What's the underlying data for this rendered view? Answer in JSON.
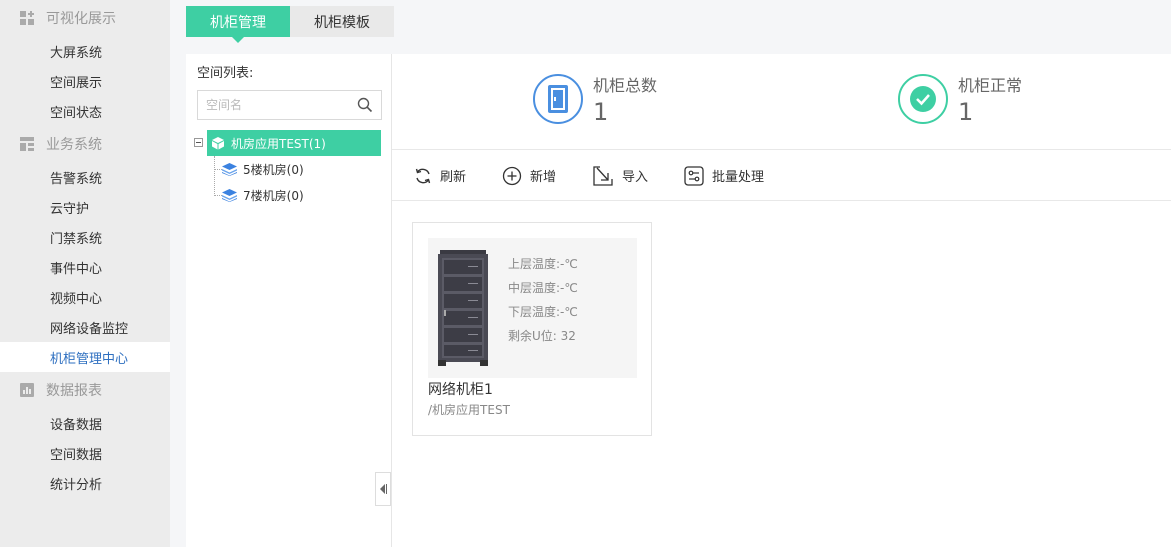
{
  "sidebar": {
    "groups": [
      {
        "title": "可视化展示",
        "icon": "grid-plus-icon",
        "items": [
          "大屏系统",
          "空间展示",
          "空间状态"
        ]
      },
      {
        "title": "业务系统",
        "icon": "layout-icon",
        "items": [
          "告警系统",
          "云守护",
          "门禁系统",
          "事件中心",
          "视频中心",
          "网络设备监控",
          "机柜管理中心"
        ]
      },
      {
        "title": "数据报表",
        "icon": "bar-chart-icon",
        "items": [
          "设备数据",
          "空间数据",
          "统计分析"
        ]
      }
    ],
    "active_item": "机柜管理中心"
  },
  "tabs": [
    {
      "label": "机柜管理",
      "active": true
    },
    {
      "label": "机柜模板",
      "active": false
    }
  ],
  "space_list": {
    "title": "空间列表:",
    "search_placeholder": "空间名",
    "root": "机房应用TEST(1)",
    "children": [
      "5楼机房(0)",
      "7楼机房(0)"
    ]
  },
  "stats": {
    "total_label": "机柜总数",
    "total_value": "1",
    "normal_label": "机柜正常",
    "normal_value": "1"
  },
  "toolbar": {
    "refresh": "刷新",
    "add": "新增",
    "import": "导入",
    "batch": "批量处理"
  },
  "cabinet": {
    "upper_temp": "上层温度:-℃",
    "middle_temp": "中层温度:-℃",
    "lower_temp": "下层温度:-℃",
    "remaining_u": "剩余U位:  32",
    "name": "网络机柜1",
    "path": "/机房应用TEST"
  },
  "colors": {
    "accent": "#3ecfa3",
    "blue": "#4a8fe0",
    "active_text": "#2e6fc0"
  }
}
